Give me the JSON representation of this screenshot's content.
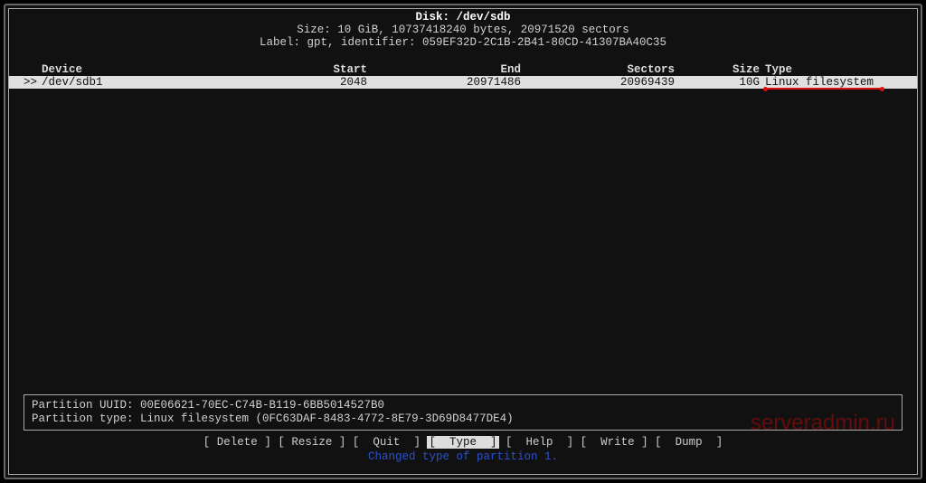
{
  "header": {
    "disk_label": "Disk: /dev/sdb",
    "size_line": "Size: 10 GiB, 10737418240 bytes, 20971520 sectors",
    "label_line": "Label: gpt, identifier: 059EF32D-2C1B-2B41-80CD-41307BA40C35"
  },
  "columns": {
    "device": "Device",
    "start": "Start",
    "end": "End",
    "sectors": "Sectors",
    "size": "Size",
    "type": "Type"
  },
  "rows": [
    {
      "marker": ">>",
      "device": "/dev/sdb1",
      "start": "2048",
      "end": "20971486",
      "sectors": "20969439",
      "size": "10G",
      "type": "Linux filesystem"
    }
  ],
  "info": {
    "uuid": "Partition UUID: 00E06621-70EC-C74B-B119-6BB5014527B0",
    "ptype": "Partition type: Linux filesystem (0FC63DAF-8483-4772-8E79-3D69D8477DE4)"
  },
  "menu": {
    "delete": "Delete",
    "resize": "Resize",
    "quit": "Quit",
    "type": "Type",
    "help": "Help",
    "write": "Write",
    "dump": "Dump"
  },
  "status": "Changed type of partition 1.",
  "watermark": "serveradmin.ru"
}
